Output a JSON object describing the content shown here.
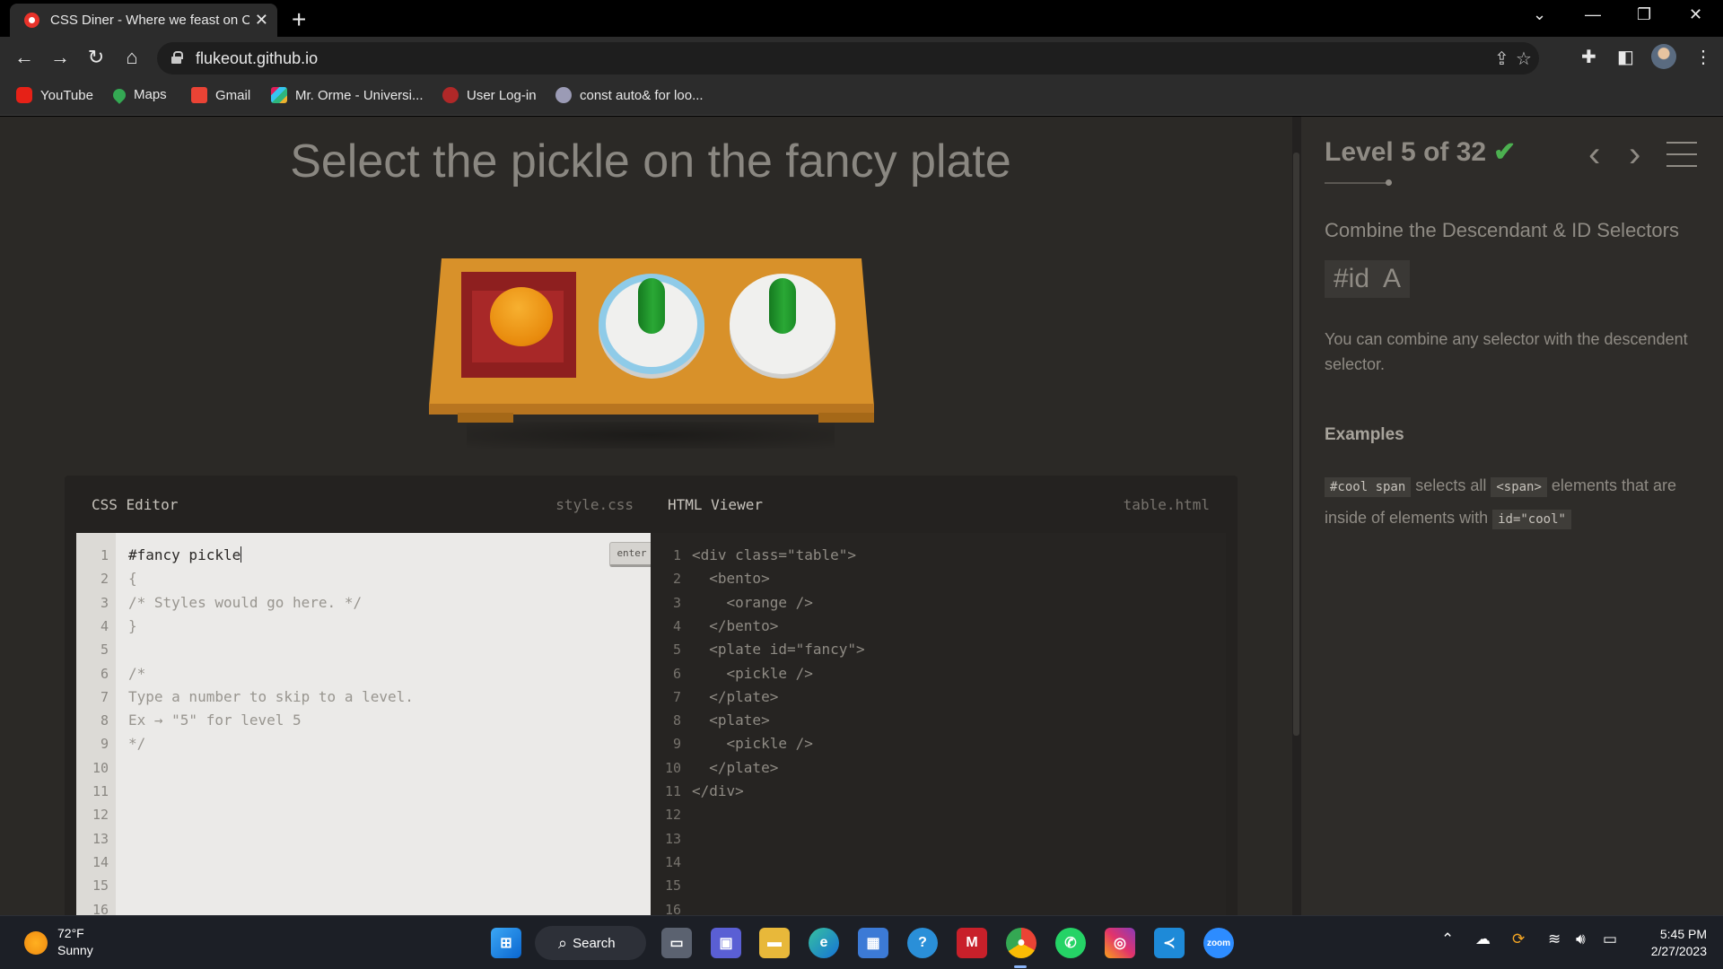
{
  "browser": {
    "tab_title": "CSS Diner - Where we feast on C",
    "url": "flukeout.github.io",
    "bookmarks": [
      "YouTube",
      "Maps",
      "Gmail",
      "Mr. Orme - Universi...",
      "User Log-in",
      "const auto& for loo..."
    ]
  },
  "game": {
    "order_text": "Select the pickle on the fancy plate",
    "css_editor": {
      "title": "CSS Editor",
      "filename": "style.css",
      "enter_label": "enter",
      "lines": [
        "#fancy pickle",
        "{",
        "/* Styles would go here. */",
        "}",
        "",
        "/*",
        "Type a number to skip to a level.",
        "Ex → \"5\" for level 5",
        "*/",
        "",
        "",
        "",
        "",
        "",
        "",
        ""
      ],
      "line_numbers": [
        "1",
        "2",
        "3",
        "4",
        "5",
        "6",
        "7",
        "8",
        "9",
        "10",
        "11",
        "12",
        "13",
        "14",
        "15",
        "16"
      ]
    },
    "html_viewer": {
      "title": "HTML Viewer",
      "filename": "table.html",
      "lines": [
        "<div class=\"table\">",
        "  <bento>",
        "    <orange />",
        "  </bento>",
        "  <plate id=\"fancy\">",
        "    <pickle />",
        "  </plate>",
        "  <plate>",
        "    <pickle />",
        "  </plate>",
        "</div>",
        "",
        "",
        "",
        "",
        ""
      ],
      "line_numbers": [
        "1",
        "2",
        "3",
        "4",
        "5",
        "6",
        "7",
        "8",
        "9",
        "10",
        "11",
        "12",
        "13",
        "14",
        "15",
        "16"
      ]
    }
  },
  "sidebar": {
    "level_title": "Level 5 of 32",
    "check_mark": "✔",
    "selector_name": "Combine the Descendant & ID Selectors",
    "syntax": "#id  A",
    "hint": "You can combine any selector with the descendent selector.",
    "examples_title": "Examples",
    "example": {
      "code1": "#cool span",
      "text1": " selects all ",
      "code2": "<span>",
      "text2": " elements that are inside of elements with ",
      "code3": "id=\"cool\""
    }
  },
  "taskbar": {
    "temperature": "72°F",
    "condition": "Sunny",
    "search_label": "Search",
    "time": "5:45 PM",
    "date": "2/27/2023"
  },
  "colors": {
    "page_bg": "#2b2926",
    "check": "#4cb050",
    "pickle": "#2aa835",
    "orange": "#e88a0c",
    "bento": "#8e1f1f",
    "fancy_plate_ring": "#8fcbe8"
  }
}
